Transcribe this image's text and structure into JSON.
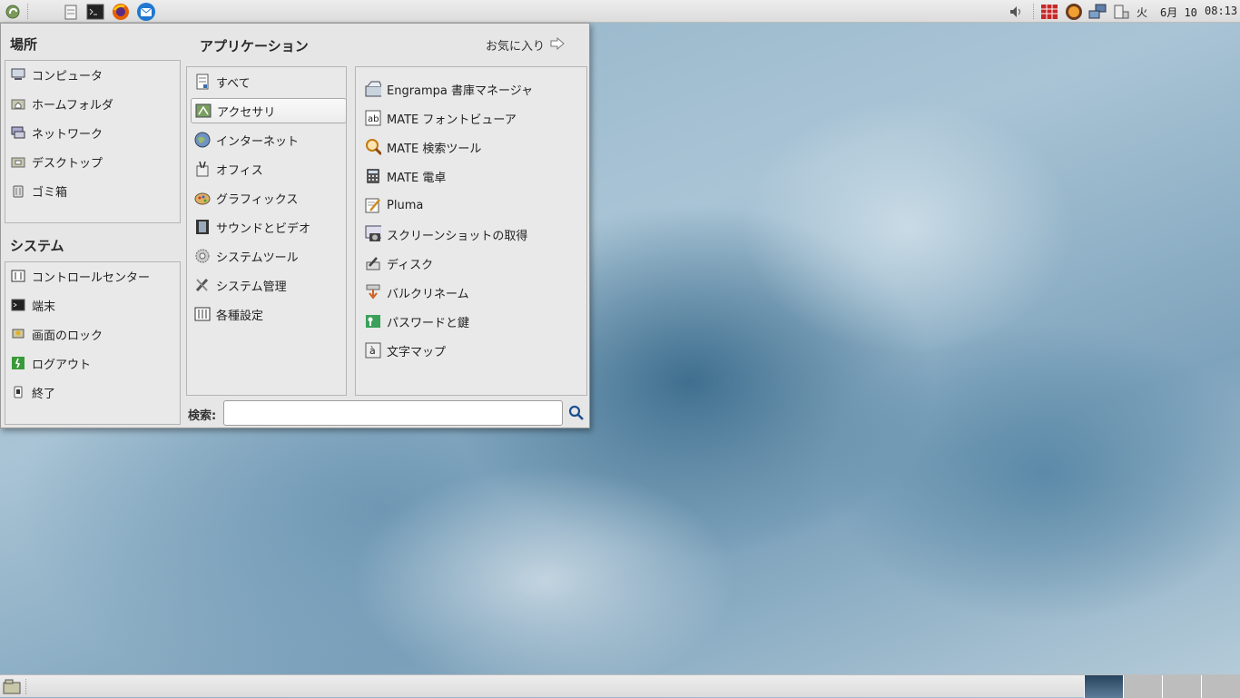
{
  "top_panel": {
    "clock": "08:13",
    "date": "6月 10",
    "weekday": "火",
    "launchers": [
      "mate-menu-icon",
      "file-manager-icon",
      "terminal-icon",
      "firefox-icon",
      "thunderbird-icon"
    ]
  },
  "places": {
    "title": "場所",
    "items": [
      {
        "label": "コンピュータ",
        "icon": "computer-icon"
      },
      {
        "label": "ホームフォルダ",
        "icon": "home-folder-icon"
      },
      {
        "label": "ネットワーク",
        "icon": "network-icon"
      },
      {
        "label": "デスクトップ",
        "icon": "desktop-folder-icon"
      },
      {
        "label": "ゴミ箱",
        "icon": "trash-icon"
      }
    ]
  },
  "system": {
    "title": "システム",
    "items": [
      {
        "label": "コントロールセンター",
        "icon": "control-center-icon"
      },
      {
        "label": "端末",
        "icon": "terminal-icon"
      },
      {
        "label": "画面のロック",
        "icon": "lock-screen-icon"
      },
      {
        "label": "ログアウト",
        "icon": "logout-icon"
      },
      {
        "label": "終了",
        "icon": "shutdown-icon"
      }
    ]
  },
  "applications": {
    "title": "アプリケーション",
    "favorites_label": "お気に入り",
    "selected_category": "アクセサリ",
    "categories": [
      {
        "label": "すべて",
        "icon": "all-apps-icon"
      },
      {
        "label": "アクセサリ",
        "icon": "accessories-icon"
      },
      {
        "label": "インターネット",
        "icon": "internet-icon"
      },
      {
        "label": "オフィス",
        "icon": "office-icon"
      },
      {
        "label": "グラフィックス",
        "icon": "graphics-icon"
      },
      {
        "label": "サウンドとビデオ",
        "icon": "sound-video-icon"
      },
      {
        "label": "システムツール",
        "icon": "system-tools-icon"
      },
      {
        "label": "システム管理",
        "icon": "system-admin-icon"
      },
      {
        "label": "各種設定",
        "icon": "preferences-icon"
      }
    ],
    "apps": [
      {
        "label": "Engrampa 書庫マネージャ",
        "icon": "archive-manager-icon"
      },
      {
        "label": "MATE フォントビューア",
        "icon": "font-viewer-icon"
      },
      {
        "label": "MATE 検索ツール",
        "icon": "search-tool-icon"
      },
      {
        "label": "MATE 電卓",
        "icon": "calculator-icon"
      },
      {
        "label": "Pluma",
        "icon": "text-editor-icon"
      },
      {
        "label": "スクリーンショットの取得",
        "icon": "screenshot-icon"
      },
      {
        "label": "ディスク",
        "icon": "disks-icon"
      },
      {
        "label": "バルクリネーム",
        "icon": "bulk-rename-icon"
      },
      {
        "label": "パスワードと鍵",
        "icon": "passwords-keys-icon"
      },
      {
        "label": "文字マップ",
        "icon": "character-map-icon"
      }
    ]
  },
  "search": {
    "label": "検索:",
    "value": ""
  },
  "colors": {
    "panel": "#e4e4e4",
    "menu_bg": "#e6e6e6",
    "accent_red": "#c62828",
    "firefox_orange": "#e66000",
    "thunderbird_blue": "#1f78d1",
    "search_blue": "#1c4f8f"
  }
}
